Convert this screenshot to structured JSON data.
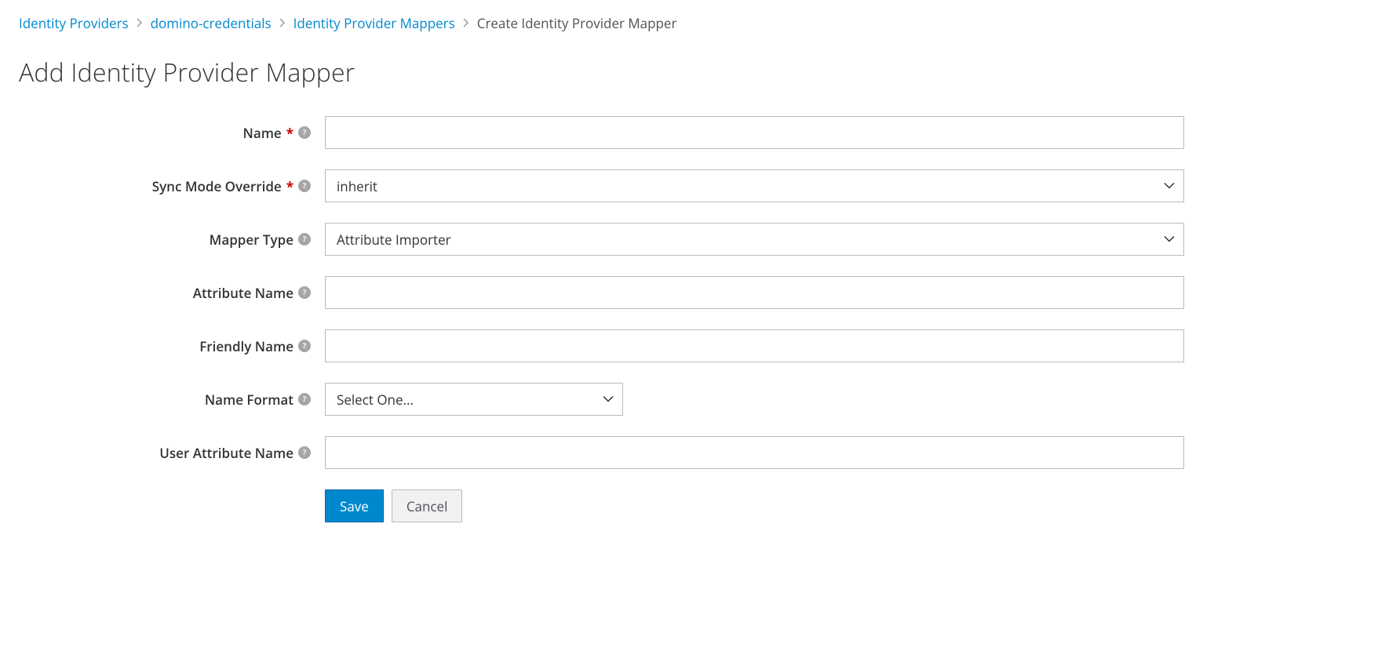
{
  "breadcrumb": {
    "items": [
      {
        "label": "Identity Providers"
      },
      {
        "label": "domino-credentials"
      },
      {
        "label": "Identity Provider Mappers"
      }
    ],
    "current": "Create Identity Provider Mapper"
  },
  "page": {
    "title": "Add Identity Provider Mapper"
  },
  "form": {
    "name": {
      "label": "Name",
      "value": ""
    },
    "sync_mode": {
      "label": "Sync Mode Override",
      "value": "inherit"
    },
    "mapper_type": {
      "label": "Mapper Type",
      "value": "Attribute Importer"
    },
    "attribute_name": {
      "label": "Attribute Name",
      "value": ""
    },
    "friendly_name": {
      "label": "Friendly Name",
      "value": ""
    },
    "name_format": {
      "label": "Name Format",
      "value": "Select One..."
    },
    "user_attribute_name": {
      "label": "User Attribute Name",
      "value": ""
    }
  },
  "buttons": {
    "save": "Save",
    "cancel": "Cancel"
  }
}
